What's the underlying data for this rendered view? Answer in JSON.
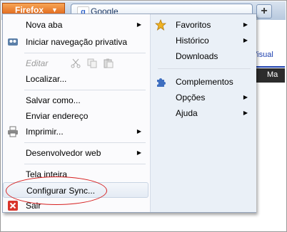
{
  "browser": {
    "button_label": "Firefox",
    "tab_title": "Google",
    "new_tab_symbol": "+"
  },
  "background_page": {
    "visual_text": "Visual",
    "dark_text": "Ma"
  },
  "menu": {
    "left": {
      "new_tab": "Nova aba",
      "private": "Iniciar navegação privativa",
      "edit": "Editar",
      "find": "Localizar...",
      "save_as": "Salvar como...",
      "send_link": "Enviar endereço",
      "print": "Imprimir...",
      "web_dev": "Desenvolvedor web",
      "fullscreen": "Tela inteira",
      "sync": "Configurar Sync...",
      "quit": "Sair"
    },
    "right": {
      "bookmarks": "Favoritos",
      "history": "Histórico",
      "downloads": "Downloads",
      "addons": "Complementos",
      "options": "Opções",
      "help": "Ajuda"
    },
    "submenu_arrow": "▶",
    "colors": {
      "annotation": "#d62020",
      "firefox_button": "#e97a24"
    }
  }
}
